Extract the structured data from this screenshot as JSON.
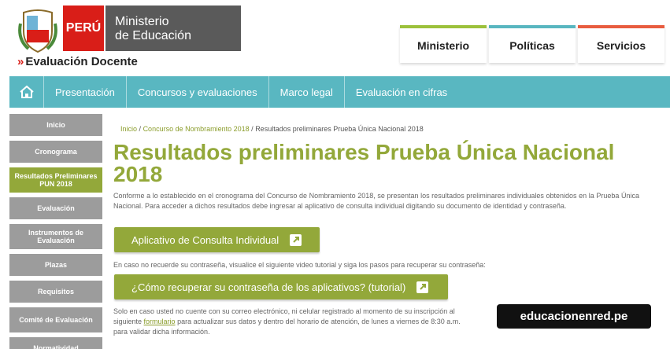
{
  "header": {
    "peru_label": "PERÚ",
    "ministry_line1": "Ministerio",
    "ministry_line2": "de Educación",
    "program_chevron": "»",
    "program_title": "Evaluación Docente"
  },
  "top_tabs": [
    {
      "label": "Ministerio",
      "color": "#9cc13b"
    },
    {
      "label": "Políticas",
      "color": "#58b6c0"
    },
    {
      "label": "Servicios",
      "color": "#e85c3f"
    }
  ],
  "main_nav": {
    "home_icon": "home-icon",
    "items": [
      "Presentación",
      "Concursos y evaluaciones",
      "Marco legal",
      "Evaluación en cifras"
    ]
  },
  "sidebar": {
    "items": [
      {
        "label": "Inicio",
        "active": false
      },
      {
        "label": "Cronograma",
        "active": false
      },
      {
        "label": "Resultados Preliminares PUN 2018",
        "active": true
      },
      {
        "label": "Evaluación",
        "active": false
      },
      {
        "label": "Instrumentos de Evaluación",
        "active": false
      },
      {
        "label": "Plazas",
        "active": false
      },
      {
        "label": "Requisitos",
        "active": false
      },
      {
        "label": "Comité de Evaluación",
        "active": false
      },
      {
        "label": "Normatividad",
        "active": false
      }
    ]
  },
  "breadcrumb": {
    "home": "Inicio",
    "sep": "/",
    "section": "Concurso de Nombramiento 2018",
    "current": "Resultados preliminares Prueba Única Nacional 2018"
  },
  "page": {
    "title": "Resultados preliminares Prueba Única Nacional 2018",
    "intro": "Conforme a lo establecido en el cronograma del Concurso de Nombramiento 2018, se presentan los resultados preliminares individuales obtenidos en la Prueba Única Nacional. Para acceder a dichos resultados debe ingresar al aplicativo de consulta individual digitando su documento de identidad y contraseña.",
    "button_consulta": "Aplicativo de Consulta Individual",
    "note": "En caso no recuerde su contraseña, visualice el siguiente video tutorial y siga los pasos para recuperar su contraseña:",
    "button_tutorial": "¿Cómo recuperar su contraseña de los aplicativos? (tutorial)",
    "footer_part1": "Solo en caso usted no cuente con su correo electrónico, ni celular registrado al momento de su inscripción al",
    "footer_part2_prefix": "siguiente",
    "footer_link": "formulario",
    "footer_part2_suffix": "para actualizar sus datos y dentro del horario de atención, de lunes a viernes de 8:30 a.m.",
    "footer_part3": "para validar dicha información."
  },
  "watermark_badge": "educacionenred.pe",
  "colors": {
    "accent_green": "#93a83a",
    "nav_teal": "#59b7c1",
    "brand_red": "#d91e18"
  }
}
